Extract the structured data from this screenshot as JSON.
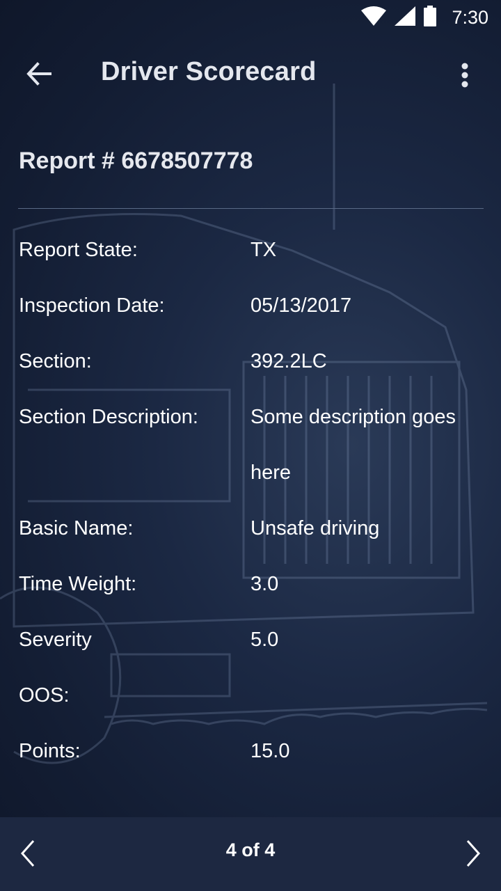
{
  "status_bar": {
    "time": "7:30",
    "icons": [
      "wifi-icon",
      "signal-icon",
      "battery-icon"
    ]
  },
  "app_bar": {
    "title": "Driver Scorecard",
    "back_icon": "arrow-back-icon",
    "menu_icon": "more-vert-icon"
  },
  "report": {
    "header": "Report # 6678507778",
    "fields": [
      {
        "label": "Report State:",
        "value": "TX"
      },
      {
        "label": "Inspection Date:",
        "value": "05/13/2017"
      },
      {
        "label": "Section:",
        "value": "392.2LC"
      },
      {
        "label": "Section Description:",
        "value": "Some description goes here"
      },
      {
        "label": "Basic Name:",
        "value": "Unsafe driving"
      },
      {
        "label": "Time Weight:",
        "value": "3.0"
      },
      {
        "label": "Severity",
        "value": "5.0"
      },
      {
        "label": "OOS:",
        "value": ""
      },
      {
        "label": "Points:",
        "value": "15.0"
      }
    ]
  },
  "pager": {
    "text": "4 of 4",
    "prev_icon": "chevron-left-icon",
    "next_icon": "chevron-right-icon"
  },
  "colors": {
    "background": "#1b2843",
    "bottom_bar": "#1d2841",
    "divider": "#5a6a86",
    "text": "#ffffff"
  }
}
